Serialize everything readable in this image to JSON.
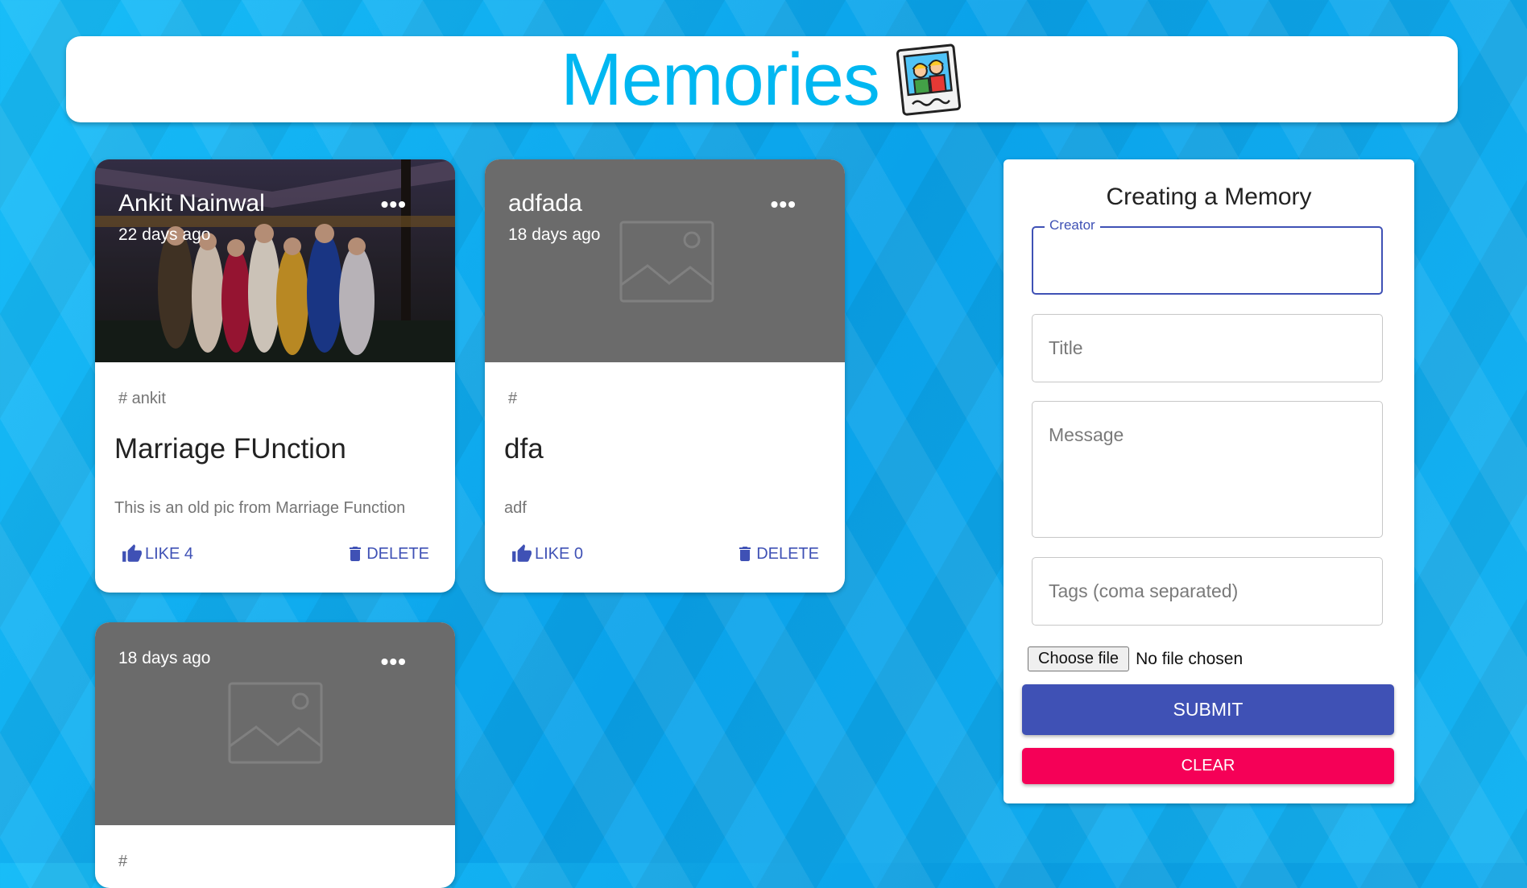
{
  "app": {
    "title": "Memories",
    "logo_icon": "polaroid-photo-icon"
  },
  "posts": [
    {
      "creator": "Ankit Nainwal",
      "time": "22 days ago",
      "has_image": true,
      "tags": "# ankit",
      "title": "Marriage FUnction",
      "message": "This is an old pic from Marriage Function",
      "like_label": "LIKE 4",
      "delete_label": "DELETE"
    },
    {
      "creator": "adfada",
      "time": "18 days ago",
      "has_image": false,
      "tags": "#",
      "title": "dfa",
      "message": "adf",
      "like_label": "LIKE 0",
      "delete_label": "DELETE"
    },
    {
      "creator": "",
      "time": "18 days ago",
      "has_image": false,
      "tags": "#"
    }
  ],
  "form": {
    "title": "Creating a Memory",
    "creator_label": "Creator",
    "title_placeholder": "Title",
    "message_placeholder": "Message",
    "tags_placeholder": "Tags (coma separated)",
    "file_button": "Choose file",
    "file_status": "No file chosen",
    "submit_label": "SUBMIT",
    "clear_label": "CLEAR"
  },
  "colors": {
    "primary": "#3f51b5",
    "secondary": "#f50057",
    "brand": "#00b7f1",
    "background": "#11b0f0"
  }
}
